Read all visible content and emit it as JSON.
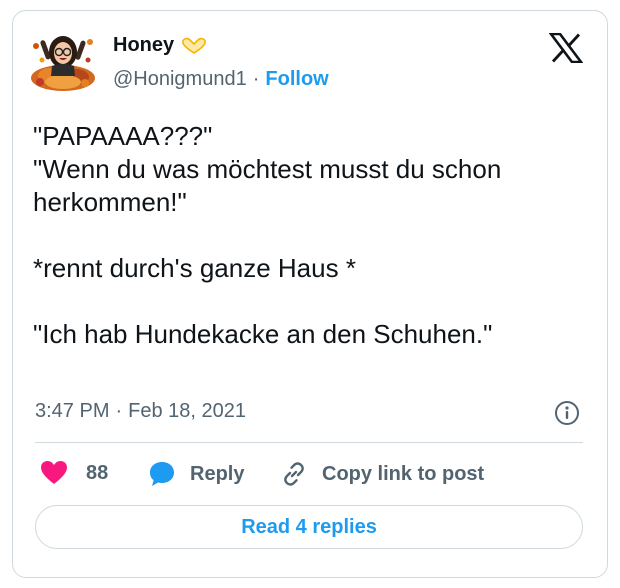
{
  "author": {
    "name": "Honey",
    "handle": "@Honigmund1",
    "separator": "·",
    "follow_label": "Follow",
    "name_emoji": "heart-hands-icon"
  },
  "tweet": {
    "lines": [
      "\"PAPAAAA???\"",
      "\"Wenn du was möchtest musst du schon",
      "herkommen!\"",
      "",
      "*rennt durch's ganze Haus *",
      "",
      "\"Ich hab Hundekacke an den Schuhen.\""
    ],
    "time": "3:47 PM",
    "separator": "·",
    "date": "Feb 18, 2021"
  },
  "actions": {
    "like_count": "88",
    "reply_label": "Reply",
    "copy_label": "Copy link to post"
  },
  "read_replies_label": "Read 4 replies",
  "colors": {
    "accent": "#1d9bf0",
    "like": "#f91880",
    "text": "#0f1419",
    "muted": "#536471",
    "border": "#cfd9de"
  }
}
